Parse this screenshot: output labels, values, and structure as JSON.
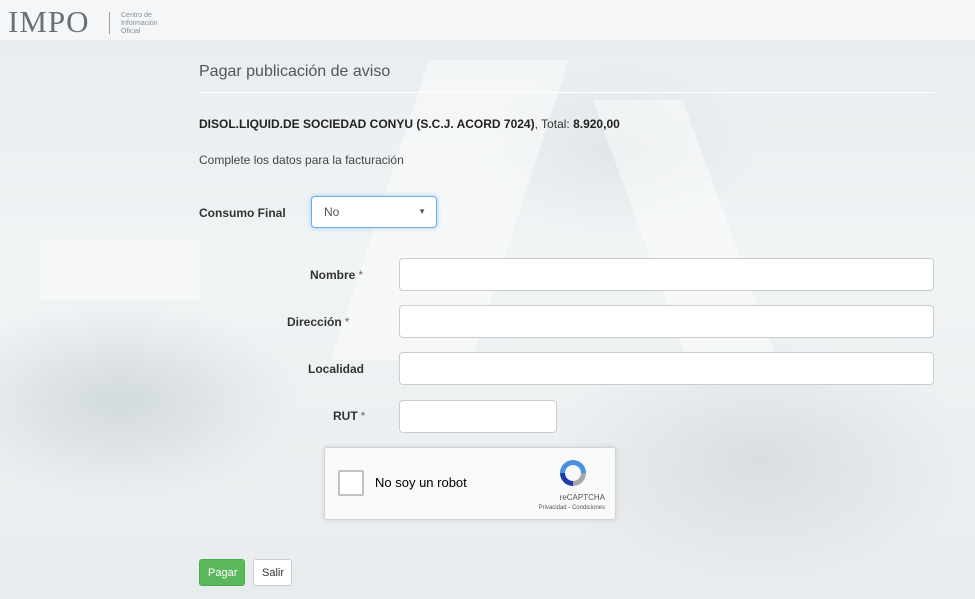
{
  "header": {
    "logo": "IMPO",
    "subtitle_lines": [
      "Centro de",
      "Información",
      "Oficial"
    ]
  },
  "page": {
    "title": "Pagar publicación de aviso",
    "notice_name": "DISOL.LIQUID.DE SOCIEDAD CONYU (S.C.J. ACORD 7024)",
    "total_label": ", Total: ",
    "total_value": "8.920,00",
    "instructions": "Complete los datos para la facturación"
  },
  "form": {
    "consumo_final": {
      "label": "Consumo Final",
      "value": "No"
    },
    "required_mark": "*",
    "nombre": {
      "label": "Nombre",
      "value": "",
      "required": true
    },
    "direccion": {
      "label": "Dirección",
      "value": "",
      "required": true
    },
    "localidad": {
      "label": "Localidad",
      "value": "",
      "required": false
    },
    "rut": {
      "label": "RUT",
      "value": "",
      "required": true
    }
  },
  "recaptcha": {
    "text": "No soy un robot",
    "brand": "reCAPTCHA",
    "links": "Privacidad - Condiciones",
    "icon": "recaptcha-logo-icon"
  },
  "buttons": {
    "pay": "Pagar",
    "exit": "Salir"
  },
  "colors": {
    "primary_green": "#5cb85c",
    "focus_blue": "#66afe9"
  }
}
